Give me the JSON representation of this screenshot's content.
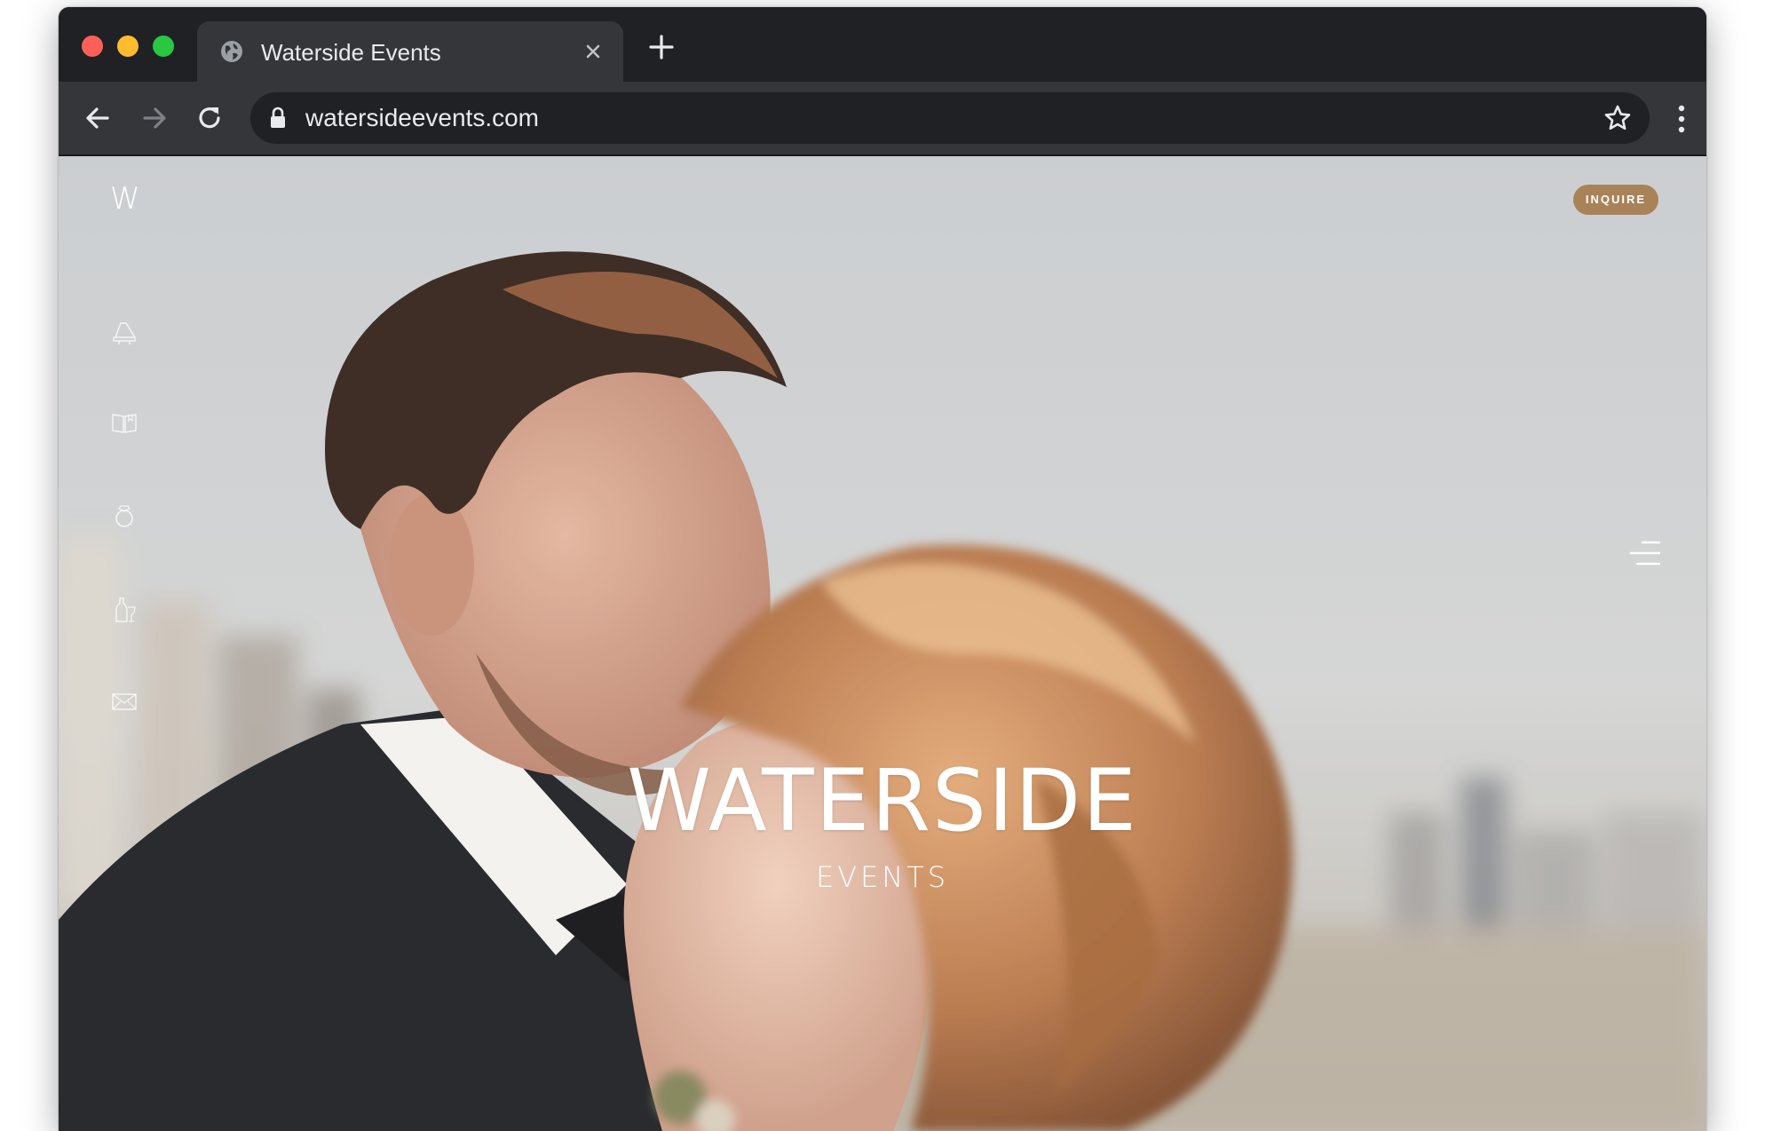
{
  "browser": {
    "tab": {
      "title": "Waterside Events",
      "favicon": "globe-icon"
    },
    "toolbar": {
      "url": "watersideevents.com"
    },
    "colors": {
      "tabstrip": "#202124",
      "toolbar": "#35363a"
    }
  },
  "site": {
    "logo": "W",
    "inquire_label": "INQUIRE",
    "inquire_color": "#a98258",
    "brand_title": "WATERSIDE",
    "brand_subtitle": "EVENTS",
    "side_nav": [
      {
        "icon": "piano-icon"
      },
      {
        "icon": "book-icon"
      },
      {
        "icon": "ring-icon"
      },
      {
        "icon": "champagne-icon"
      },
      {
        "icon": "envelope-icon"
      }
    ],
    "menu_icon": "hamburger-menu-icon"
  }
}
